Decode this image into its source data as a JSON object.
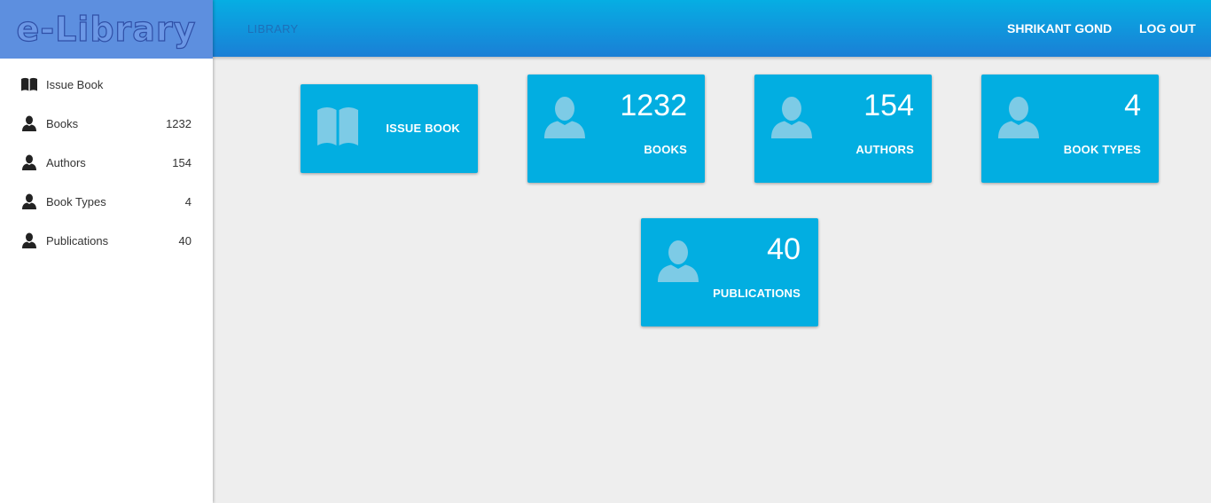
{
  "app": {
    "logo_text": "e-Library"
  },
  "topbar": {
    "title": "LIBRARY",
    "user": "SHRIKANT GOND",
    "logout": "LOG OUT"
  },
  "sidebar": {
    "items": [
      {
        "label": "Issue Book",
        "count": "",
        "icon": "book-open-icon"
      },
      {
        "label": "Books",
        "count": "1232",
        "icon": "person-icon"
      },
      {
        "label": "Authors",
        "count": "154",
        "icon": "person-icon"
      },
      {
        "label": "Book Types",
        "count": "4",
        "icon": "person-icon"
      },
      {
        "label": "Publications",
        "count": "40",
        "icon": "person-icon"
      }
    ]
  },
  "cards": [
    {
      "label": "ISSUE BOOK",
      "number": "",
      "icon": "book-open-icon"
    },
    {
      "label": "BOOKS",
      "number": "1232",
      "icon": "person-icon"
    },
    {
      "label": "AUTHORS",
      "number": "154",
      "icon": "person-icon"
    },
    {
      "label": "BOOK TYPES",
      "number": "4",
      "icon": "person-icon"
    },
    {
      "label": "PUBLICATIONS",
      "number": "40",
      "icon": "person-icon"
    }
  ],
  "colors": {
    "card_bg": "#02aee1",
    "topbar_top": "#06aee3",
    "topbar_bottom": "#1a7fd6",
    "logo_bg": "#5d8fdf",
    "page_bg": "#eeeeee"
  }
}
